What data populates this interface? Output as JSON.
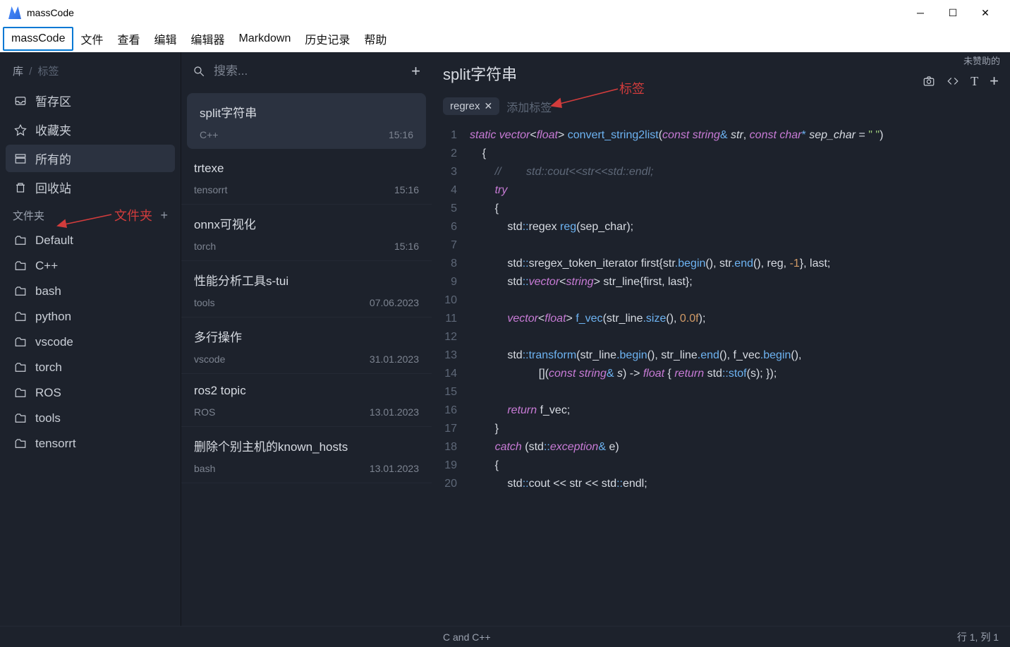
{
  "window": {
    "title": "massCode"
  },
  "menu": [
    "massCode",
    "文件",
    "查看",
    "编辑",
    "编辑器",
    "Markdown",
    "历史记录",
    "帮助"
  ],
  "activeMenuIndex": 0,
  "sidebar": {
    "crumbs": {
      "library": "库",
      "tags": "标签"
    },
    "library": [
      {
        "icon": "inbox",
        "label": "暂存区"
      },
      {
        "icon": "star",
        "label": "收藏夹"
      },
      {
        "icon": "all",
        "label": "所有的",
        "selected": true
      },
      {
        "icon": "trash",
        "label": "回收站"
      }
    ],
    "foldersHeader": "文件夹",
    "folders": [
      "Default",
      "C++",
      "bash",
      "python",
      "vscode",
      "torch",
      "ROS",
      "tools",
      "tensorrt"
    ]
  },
  "snippets": {
    "searchPlaceholder": "搜索...",
    "items": [
      {
        "title": "split字符串",
        "folder": "C++",
        "time": "15:16",
        "selected": true
      },
      {
        "title": "trtexe",
        "folder": "tensorrt",
        "time": "15:16"
      },
      {
        "title": "onnx可视化",
        "folder": "torch",
        "time": "15:16"
      },
      {
        "title": "性能分析工具s-tui",
        "folder": "tools",
        "time": "07.06.2023"
      },
      {
        "title": "多行操作",
        "folder": "vscode",
        "time": "31.01.2023"
      },
      {
        "title": "ros2 topic",
        "folder": "ROS",
        "time": "13.01.2023"
      },
      {
        "title": "删除个别主机的known_hosts",
        "folder": "bash",
        "time": "13.01.2023"
      }
    ]
  },
  "editor": {
    "title": "split字符串",
    "unsponsored": "未赞助的",
    "tag": "regrex",
    "addTagPlaceholder": "添加标签",
    "lang": "C and C++",
    "cursor": "行 1, 列 1"
  },
  "annotations": {
    "tags": "标签",
    "folders": "文件夹"
  },
  "code": [
    [
      [
        "kw",
        "static"
      ],
      [
        "pn",
        " "
      ],
      [
        "ty",
        "vector"
      ],
      [
        "pn",
        "<"
      ],
      [
        "ty",
        "float"
      ],
      [
        "pn",
        "> "
      ],
      [
        "fn",
        "convert_string2list"
      ],
      [
        "pn",
        "("
      ],
      [
        "kw",
        "const"
      ],
      [
        "pn",
        " "
      ],
      [
        "ty",
        "string"
      ],
      [
        "op",
        "&"
      ],
      [
        "pn",
        " "
      ],
      [
        "var",
        "str"
      ],
      [
        "pn",
        ", "
      ],
      [
        "kw",
        "const"
      ],
      [
        "pn",
        " "
      ],
      [
        "ty",
        "char"
      ],
      [
        "op",
        "*"
      ],
      [
        "pn",
        " "
      ],
      [
        "var",
        "sep_char"
      ],
      [
        "pn",
        " = "
      ],
      [
        "str",
        "\" \""
      ],
      [
        "pn",
        ")"
      ]
    ],
    [
      [
        "pn",
        "    {"
      ]
    ],
    [
      [
        "pn",
        "        "
      ],
      [
        "cm",
        "//        std::cout<<str<<std::endl;"
      ]
    ],
    [
      [
        "pn",
        "        "
      ],
      [
        "kw",
        "try"
      ]
    ],
    [
      [
        "pn",
        "        {"
      ]
    ],
    [
      [
        "pn",
        "            std"
      ],
      [
        "op",
        "::"
      ],
      [
        "pn",
        "regex "
      ],
      [
        "fn",
        "reg"
      ],
      [
        "pn",
        "(sep_char);"
      ]
    ],
    [
      [
        "pn",
        ""
      ]
    ],
    [
      [
        "pn",
        "            std"
      ],
      [
        "op",
        "::"
      ],
      [
        "pn",
        "sregex_token_iterator first{str"
      ],
      [
        "op",
        "."
      ],
      [
        "fn",
        "begin"
      ],
      [
        "pn",
        "(), str"
      ],
      [
        "op",
        "."
      ],
      [
        "fn",
        "end"
      ],
      [
        "pn",
        "(), reg, "
      ],
      [
        "num",
        "-1"
      ],
      [
        "pn",
        "}, last;"
      ]
    ],
    [
      [
        "pn",
        "            std"
      ],
      [
        "op",
        "::"
      ],
      [
        "ty",
        "vector"
      ],
      [
        "pn",
        "<"
      ],
      [
        "ty",
        "string"
      ],
      [
        "pn",
        "> str_line{first, last};"
      ]
    ],
    [
      [
        "pn",
        ""
      ]
    ],
    [
      [
        "pn",
        "            "
      ],
      [
        "ty",
        "vector"
      ],
      [
        "pn",
        "<"
      ],
      [
        "ty",
        "float"
      ],
      [
        "pn",
        "> "
      ],
      [
        "fn",
        "f_vec"
      ],
      [
        "pn",
        "(str_line"
      ],
      [
        "op",
        "."
      ],
      [
        "fn",
        "size"
      ],
      [
        "pn",
        "(), "
      ],
      [
        "num",
        "0.0f"
      ],
      [
        "pn",
        ");"
      ]
    ],
    [
      [
        "pn",
        ""
      ]
    ],
    [
      [
        "pn",
        "            std"
      ],
      [
        "op",
        "::"
      ],
      [
        "fn",
        "transform"
      ],
      [
        "pn",
        "(str_line"
      ],
      [
        "op",
        "."
      ],
      [
        "fn",
        "begin"
      ],
      [
        "pn",
        "(), str_line"
      ],
      [
        "op",
        "."
      ],
      [
        "fn",
        "end"
      ],
      [
        "pn",
        "(), f_vec"
      ],
      [
        "op",
        "."
      ],
      [
        "fn",
        "begin"
      ],
      [
        "pn",
        "(),"
      ]
    ],
    [
      [
        "pn",
        "                      []("
      ],
      [
        "kw",
        "const"
      ],
      [
        "pn",
        " "
      ],
      [
        "ty",
        "string"
      ],
      [
        "op",
        "&"
      ],
      [
        "pn",
        " "
      ],
      [
        "var",
        "s"
      ],
      [
        "pn",
        ") -> "
      ],
      [
        "ty",
        "float"
      ],
      [
        "pn",
        " { "
      ],
      [
        "kw",
        "return"
      ],
      [
        "pn",
        " std"
      ],
      [
        "op",
        "::"
      ],
      [
        "fn",
        "stof"
      ],
      [
        "pn",
        "(s); });"
      ]
    ],
    [
      [
        "pn",
        ""
      ]
    ],
    [
      [
        "pn",
        "            "
      ],
      [
        "kw",
        "return"
      ],
      [
        "pn",
        " f_vec;"
      ]
    ],
    [
      [
        "pn",
        "        }"
      ]
    ],
    [
      [
        "pn",
        "        "
      ],
      [
        "kw",
        "catch"
      ],
      [
        "pn",
        " (std"
      ],
      [
        "op",
        "::"
      ],
      [
        "ty",
        "exception"
      ],
      [
        "op",
        "&"
      ],
      [
        "pn",
        " e)"
      ]
    ],
    [
      [
        "pn",
        "        {"
      ]
    ],
    [
      [
        "pn",
        "            std"
      ],
      [
        "op",
        "::"
      ],
      [
        "pn",
        "cout << str << std"
      ],
      [
        "op",
        "::"
      ],
      [
        "pn",
        "endl;"
      ]
    ]
  ]
}
